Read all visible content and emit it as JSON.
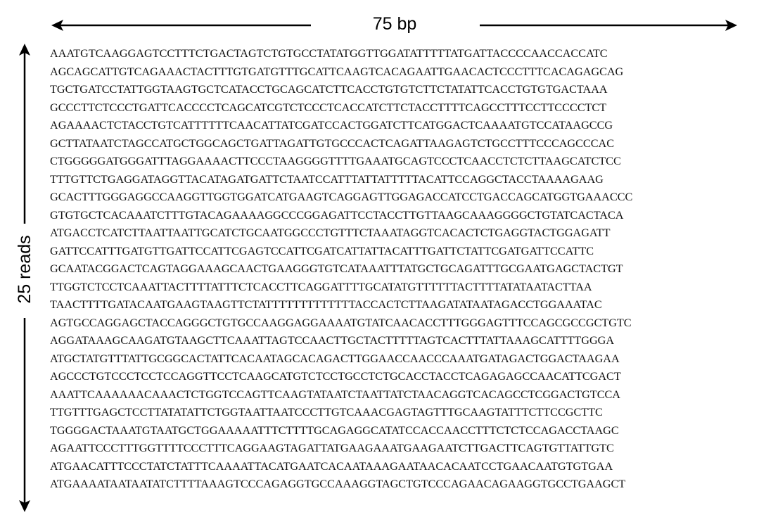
{
  "labels": {
    "width": "75 bp",
    "height": "25 reads"
  },
  "reads": [
    "AAATGTCAAGGAGTCCTTTCTGACTAGTCTGTGCCTATATGGTTGGATATTTTTATGATTACCCCAACCACCATC",
    "AGCAGCATTGTCAGAAACTACTTTGTGATGTTTGCATTCAAGTCACAGAATTGAACACTCCCTTTCACAGAGCAG",
    "TGCTGATCCTATTGGTAAGTGCTCATACCTGCAGCATCTTCACCTGTGTCTTCTATATTCACCTGTGTGACTAAA",
    "GCCCTTCTCCCTGATTCACCCCTCAGCATCGTCTCCCTCACCATCTTCTACCTTTTCAGCCTTTCCTTCCCCTCT",
    "AGAAAACTCTACCTGTCATTTTTTCAACATTATCGATCCACTGGATCTTCATGGACTCAAAATGTCCATAAGCCG",
    "GCTTATAATCTAGCCATGCTGGCAGCTGATTAGATTGTGCCCACTCAGATTAAGAGTCTGCCTTTCCCAGCCCAC",
    "CTGGGGGATGGGATTTAGGAAAACTTCCCTAAGGGGTTTTGAAATGCAGTCCCTCAACCTCTCTTAAGCATCTCC",
    "TTTGTTCTGAGGATAGGTTACATAGATGATTCTAATCCATTTATTATTTTTACATTCCAGGCTACCTAAAAGAAG",
    "GCACTTTGGGAGGCCAAGGTTGGTGGATCATGAAGTCAGGAGTTGGAGACCATCCTGACCAGCATGGTGAAACCC",
    "GTGTGCTCACAAATCTTTGTACAGAAAAGGCCCGGAGATTCCTACCTTGTTAAGCAAAGGGGCTGTATCACTACA",
    "ATGACCTCATCTTAATTAATTGCATCTGCAATGGCCCTGTTTCTAAATAGGTCACACTCTGAGGTACTGGAGATT",
    "GATTCCATTTGATGTTGATTCCATTCGAGTCCATTCGATCATTATTACATTTGATTCTATTCGATGATTCCATTC",
    "GCAATACGGACTCAGTAGGAAAGCAACTGAAGGGTGTCATAAATTTATGCTGCAGATTTGCGAATGAGCTACTGT",
    "TTGGTCTCCTCAAATTACTTTTATTTCTCACCTTCAGGATTTTGCATATGTTTTTTACTTTTATATAATACTTAA",
    "TAACTTTTGATACAATGAAGTAAGTTCTATTTTTTTTTTTTTACCACTCTTAAGATATAATAGACCTGGAAATAC",
    "AGTGCCAGGAGCTACCAGGGCTGTGCCAAGGAGGAAAATGTATCAACACCTTTGGGAGTTTCCAGCGCCGCTGTC",
    "AGGATAAAGCAAGATGTAAGCTTCAAATTAGTCCAACTTGCTACTTTTTAGTCACTTTATTAAAGCATTTTGGGA",
    "ATGCTATGTTTATTGCGGCACTATTCACAATAGCACAGACTTGGAACCAACCCAAATGATAGACTGGACTAAGAA",
    "AGCCCTGTCCCTCCTCCAGGTTCCTCAAGCATGTCTCCTGCCTCTGCACCTACCTCAGAGAGCCAACATTCGACT",
    "AAATTCAAAAAACAAACTCTGGTCCAGTTCAAGTATAATCTAATTATCTAACAGGTCACAGCCTCGGACTGTCCA",
    "TTGTTTGAGCTCCTTATATATTCTGGTAATTAATCCCTTGTCAAACGAGTAGTTTGCAAGTATTTCTTCCGCTTC",
    "TGGGGACTAAATGTAATGCTGGAAAAATTTCTTTTGCAGAGGCATATCCACCAACCTTTCTCTCCAGACCTAAGC",
    "AGAATTCCCTTTGGTTTTCCCTTTCAGGAAGTAGATTATGAAGAAATGAAGAATCTTGACTTCAGTGTTATTGTC",
    "ATGAACATTTCCCTATCTATTTCAAAATTACATGAATCACAATAAAGAATAACACAATCCTGAACAATGTGTGAA",
    "ATGAAAATAATAATATCTTTTAAAGTCCCAGAGGTGCCAAAGGTAGCTGTCCCAGAACAGAAGGTGCCTGAAGCT"
  ]
}
